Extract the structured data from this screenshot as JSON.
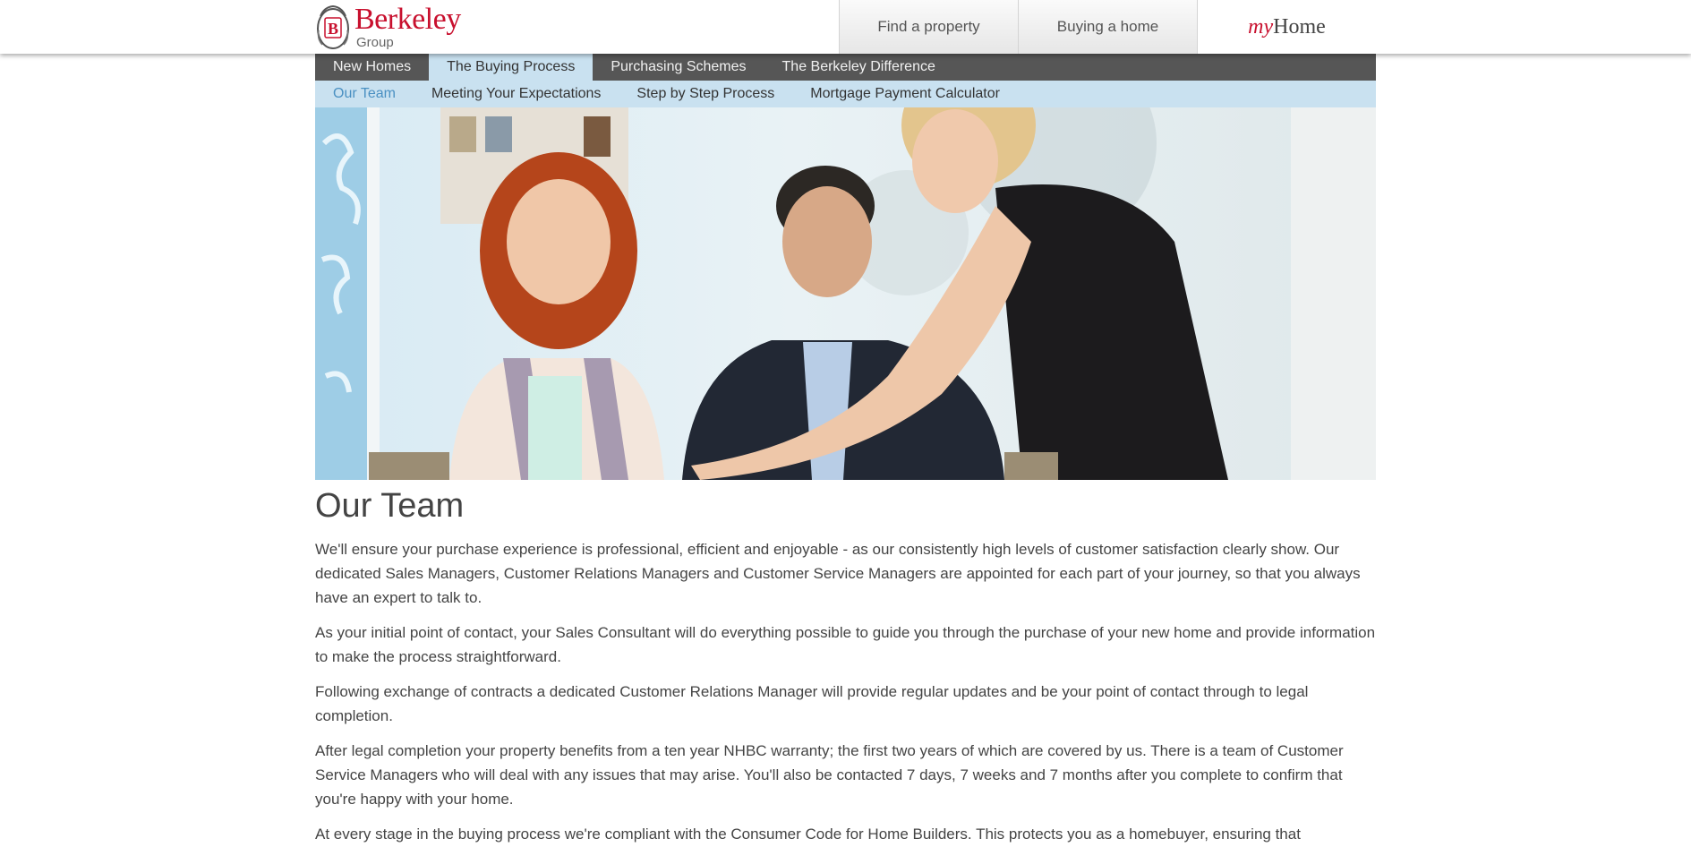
{
  "brand": {
    "logo_name": "Berkeley",
    "logo_sub": "Group",
    "logo_crest_letter": "B"
  },
  "top_links": [
    {
      "label": "Find a property"
    },
    {
      "label": "Buying a home"
    }
  ],
  "myhome": {
    "my": "my",
    "home": "Home"
  },
  "main_nav": [
    {
      "label": "New Homes",
      "active": false
    },
    {
      "label": "The Buying Process",
      "active": true
    },
    {
      "label": "Purchasing Schemes",
      "active": false
    },
    {
      "label": "The Berkeley Difference",
      "active": false
    }
  ],
  "sub_nav": [
    {
      "label": "Our Team",
      "active": true
    },
    {
      "label": "Meeting Your Expectations",
      "active": false
    },
    {
      "label": "Step by Step Process",
      "active": false
    },
    {
      "label": "Mortgage Payment Calculator",
      "active": false
    }
  ],
  "hero": {
    "icon": "team-photo"
  },
  "content": {
    "title": "Our Team",
    "paragraphs": [
      "We'll ensure your purchase experience is professional, efficient and enjoyable - as our consistently high levels of customer satisfaction clearly show. Our dedicated Sales Managers, Customer Relations Managers and Customer Service Managers are appointed for each part of your journey, so that you always have an expert to talk to.",
      "As your initial point of contact, your Sales Consultant will do everything possible to guide you through the purchase of your new home and provide information to make the process straightforward.",
      "Following exchange of contracts a dedicated Customer Relations Manager will provide regular updates and be your point of contact through to legal completion.",
      "After legal completion your property benefits from a ten year NHBC warranty; the first two years of which are covered by us. There is a team of Customer Service Managers who will deal with any issues that may arise. You'll also be contacted 7 days, 7 weeks and 7 months after you complete to confirm that you're happy with your home.",
      "At every stage in the buying process we're compliant with the Consumer Code for Home Builders. This protects you as a homebuyer, ensuring that"
    ]
  },
  "colors": {
    "brand_red": "#c8102e",
    "nav_dark": "#565656",
    "nav_light": "#c9e1f0",
    "active_link": "#4a90c2"
  }
}
